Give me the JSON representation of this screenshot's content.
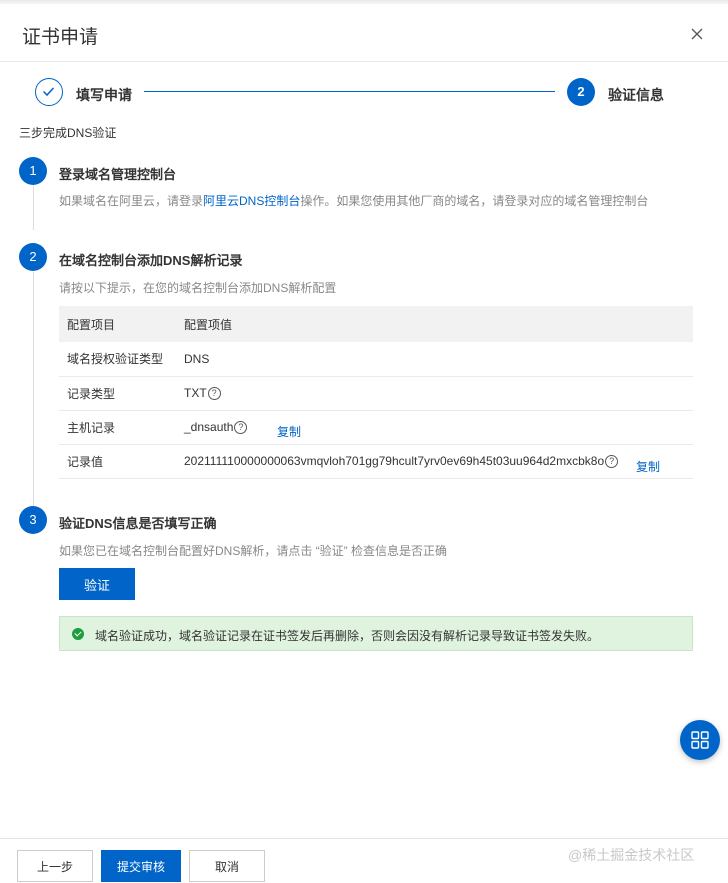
{
  "dialog": {
    "title": "证书申请"
  },
  "steps": [
    {
      "label": "填写申请",
      "state": "done"
    },
    {
      "number": "2",
      "label": "验证信息",
      "state": "active"
    }
  ],
  "subtitle": "三步完成DNS验证",
  "section1": {
    "number": "1",
    "title": "登录域名管理控制台",
    "desc_pre": "如果域名在阿里云，请登录",
    "desc_link": "阿里云DNS控制台",
    "desc_post": "操作。如果您使用其他厂商的域名，请登录对应的域名管理控制台"
  },
  "section2": {
    "number": "2",
    "title": "在域名控制台添加DNS解析记录",
    "desc": "请按以下提示，在您的域名控制台添加DNS解析配置",
    "table": {
      "headers": [
        "配置项目",
        "配置项值"
      ],
      "rows": [
        {
          "key": "域名授权验证类型",
          "value": "DNS"
        },
        {
          "key": "记录类型",
          "value": "TXT"
        },
        {
          "key": "主机记录",
          "value": "_dnsauth"
        },
        {
          "key": "记录值",
          "value": "202111110000000063vmqvloh701gg79hcult7yrv0ev69h45t03uu964d2mxcbk8o"
        }
      ],
      "copy_label": "复制",
      "help_glyph": "?"
    }
  },
  "section3": {
    "number": "3",
    "title": "验证DNS信息是否填写正确",
    "desc": "如果您已在域名控制台配置好DNS解析，请点击 “验证” 检查信息是否正确",
    "button": "验证"
  },
  "alert": {
    "message": "域名验证成功，域名验证记录在证书签发后再删除，否则会因没有解析记录导致证书签发失败。"
  },
  "footer": {
    "prev": "上一步",
    "submit": "提交审核",
    "cancel": "取消",
    "watermark": "@稀土掘金技术社区"
  },
  "colors": {
    "primary": "#0064c8",
    "success_bg": "#dff3df",
    "success_icon": "#1e9e3e"
  },
  "icons": {
    "close": "close-icon",
    "check": "check-icon",
    "success": "success-check-icon",
    "fab": "grid-apps-icon"
  }
}
